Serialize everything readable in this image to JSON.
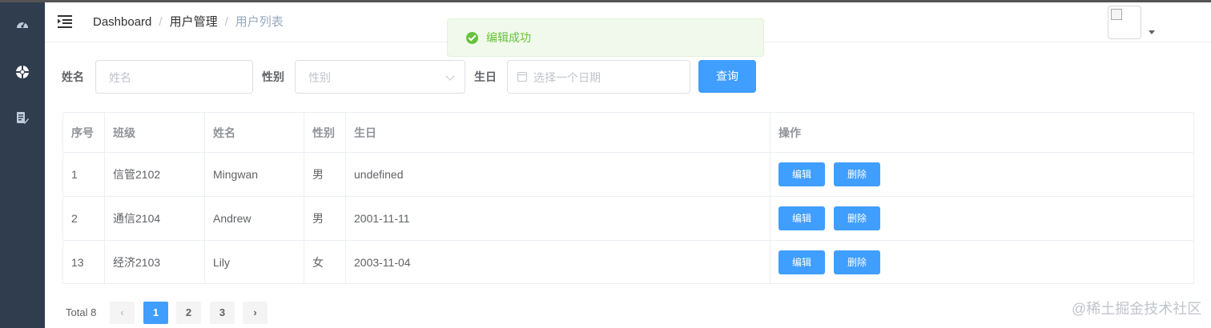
{
  "navbar": {
    "breadcrumb": [
      "Dashboard",
      "用户管理",
      "用户列表"
    ],
    "separator": "/"
  },
  "sidebar": {
    "icons": [
      "dashboard-icon",
      "lifebuoy-icon",
      "document-edit-icon"
    ]
  },
  "message": {
    "text": "编辑成功",
    "type": "success",
    "color": "#67c23a"
  },
  "search": {
    "name_label": "姓名",
    "name_placeholder": "姓名",
    "gender_label": "性别",
    "gender_placeholder": "性别",
    "birthday_label": "生日",
    "birthday_placeholder": "选择一个日期",
    "query_button": "查询"
  },
  "table": {
    "columns": [
      "序号",
      "班级",
      "姓名",
      "性别",
      "生日",
      "操作"
    ],
    "rows": [
      {
        "id": "1",
        "class": "信管2102",
        "name": "Mingwan",
        "gender": "男",
        "birthday": "undefined"
      },
      {
        "id": "2",
        "class": "通信2104",
        "name": "Andrew",
        "gender": "男",
        "birthday": "2001-11-11"
      },
      {
        "id": "13",
        "class": "经济2103",
        "name": "Lily",
        "gender": "女",
        "birthday": "2003-11-04"
      }
    ],
    "edit_label": "编辑",
    "delete_label": "删除"
  },
  "pagination": {
    "total_label": "Total 8",
    "pages": [
      "1",
      "2",
      "3"
    ],
    "current": "1",
    "prev": "‹",
    "next": "›"
  },
  "watermark": "@稀土掘金技术社区",
  "colors": {
    "primary": "#409eff",
    "sidebar": "#2f3d4f",
    "success": "#67c23a"
  }
}
